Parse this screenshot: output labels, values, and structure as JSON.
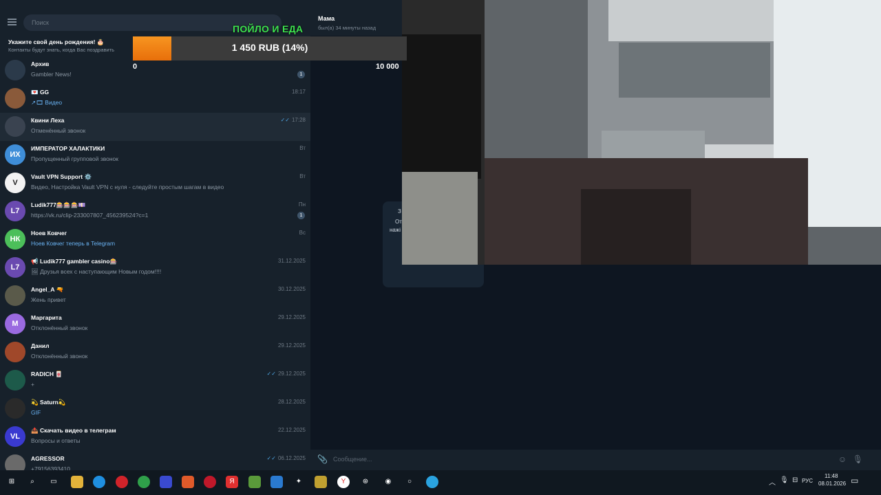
{
  "search": {
    "placeholder": "Поиск"
  },
  "birthday": {
    "title": "Укажите свой день рождения! 🎂",
    "subtitle": "Контакты будут знать, когда Вас поздравить"
  },
  "chats": [
    {
      "name": "Архив",
      "message": "Gambler News!",
      "time": "",
      "badge": "1",
      "av_text": "",
      "av_color": "#2b3a4a",
      "link": false
    },
    {
      "name": "💌 GG",
      "message": "↗🎞 Видео",
      "time": "18:17",
      "badge": "",
      "av_text": "",
      "av_color": "#8a5a3a",
      "link": true
    },
    {
      "name": "Квини Леха",
      "message": "Отменённый звонок",
      "time": "17:28",
      "read": true,
      "badge": "",
      "av_text": "",
      "av_color": "#3a4350",
      "link": false,
      "hover": true
    },
    {
      "name": "ИМПЕРАТОР ХАЛАКТИКИ",
      "message": "Пропущенный групповой звонок",
      "time": "Вт",
      "badge": "",
      "av_text": "ИХ",
      "av_color": "#3f8ed8",
      "link": false
    },
    {
      "name": "Vault VPN Support ⚙️",
      "message": "Видео, Настройка Vault VPN с нуля - следуйте простым шагам в видео",
      "time": "Вт",
      "badge": "",
      "av_text": "V",
      "av_color": "#f2f2f2",
      "link": false
    },
    {
      "name": "Ludik777🎰🎰🎰💷",
      "message": "https://vk.ru/clip-233007807_456239524?c=1",
      "time": "Пн",
      "badge": "1",
      "av_text": "L7",
      "av_color": "#6a4ab0",
      "link": false
    },
    {
      "name": "Ноев Ковчег",
      "message": "Ноев Ковчег теперь в Telegram",
      "time": "Вс",
      "badge": "",
      "av_text": "НК",
      "av_color": "#4cbf5a",
      "link": true
    },
    {
      "name": "📢 Ludik777 gambler casino🎰",
      "message": "🖼 Друзья всех с наступающим Новым годом!!!!",
      "time": "31.12.2025",
      "badge": "",
      "av_text": "L7",
      "av_color": "#6a4ab0",
      "link": false
    },
    {
      "name": "Angel_A 🔫",
      "message": "Жень привет",
      "time": "30.12.2025",
      "badge": "",
      "av_text": "",
      "av_color": "#5a5a4a",
      "link": false
    },
    {
      "name": "Маргарита",
      "message": "Отклонённый звонок",
      "time": "29.12.2025",
      "badge": "",
      "av_text": "М",
      "av_color": "#9a6ae0",
      "link": false
    },
    {
      "name": "Данил",
      "message": "Отклонённый звонок",
      "time": "29.12.2025",
      "badge": "",
      "av_text": "",
      "av_color": "#a0482a",
      "link": false
    },
    {
      "name": "RADICH 🀄",
      "message": "+",
      "time": "29.12.2025",
      "read": true,
      "badge": "",
      "av_text": "",
      "av_color": "#1d5a4a",
      "link": false
    },
    {
      "name": "💫 Saturn💫",
      "message": "GIF",
      "time": "28.12.2025",
      "badge": "",
      "av_text": "",
      "av_color": "#2a2a2a",
      "link": true
    },
    {
      "name": "📤 Скачать видео в телеграм",
      "message": "Вопросы и ответы",
      "time": "22.12.2025",
      "badge": "",
      "av_text": "VL",
      "av_color": "#3a3ad0",
      "link": false
    },
    {
      "name": "AGRESSOR",
      "message": "+79156393410",
      "time": "06.12.2025",
      "read": true,
      "badge": "",
      "av_text": "",
      "av_color": "#6a6a6a",
      "link": false
    }
  ],
  "chat_header": {
    "name": "Мама",
    "status": "был(а) 34 минуты назад"
  },
  "bubble": {
    "line1": "З",
    "line2": "От",
    "line3": "нажі"
  },
  "composer": {
    "placeholder": "Сообщение..."
  },
  "overlay": {
    "title": "ПОЙЛО И ЕДА"
  },
  "goal": {
    "text": "1 450 RUB (14%)",
    "progress": 0.14,
    "min": "0",
    "max": "10 000"
  },
  "taskbar": {
    "lang": "РУС",
    "time": "11:48",
    "date": "08.01.2026"
  }
}
